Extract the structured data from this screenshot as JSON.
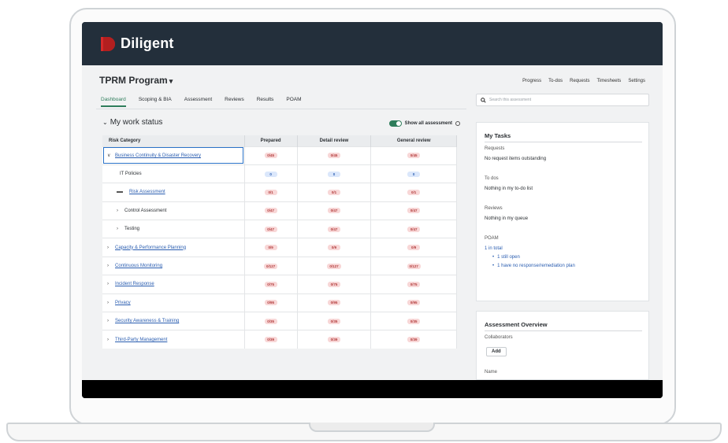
{
  "brand": {
    "name": "Diligent",
    "color": "#d72a2a"
  },
  "header": {
    "title": "TPRM Program",
    "links": [
      "Progress",
      "To-dos",
      "Requests",
      "Timesheets",
      "Settings"
    ],
    "search_placeholder": "Search this assessment"
  },
  "tabs": [
    {
      "label": "Dashboard",
      "active": true
    },
    {
      "label": "Scoping & BIA",
      "active": false
    },
    {
      "label": "Assessment",
      "active": false
    },
    {
      "label": "Reviews",
      "active": false
    },
    {
      "label": "Results",
      "active": false
    },
    {
      "label": "POAM",
      "active": false
    }
  ],
  "work_status": {
    "title": "My work status",
    "toggle_label": "Show all assessment",
    "toggle_on": true,
    "columns": [
      "Risk Category",
      "Prepared",
      "Detail review",
      "General review"
    ],
    "rows": [
      {
        "label": "Business Continuity & Disaster Recovery",
        "style": "link",
        "indent": 0,
        "expander": "open",
        "selected": true,
        "values": [
          "0/45",
          "0/45",
          "0/45"
        ],
        "badge": "red"
      },
      {
        "label": "IT Policies",
        "style": "plain",
        "indent": 2,
        "expander": "none",
        "selected": false,
        "values": [
          "0",
          "0",
          "0"
        ],
        "badge": "blue"
      },
      {
        "label": "Risk Assessment",
        "style": "link",
        "indent": 1,
        "expander": "bar",
        "selected": false,
        "values": [
          "0/1",
          "0/1",
          "0/1"
        ],
        "badge": "red"
      },
      {
        "label": "Control Assessment",
        "style": "plain",
        "indent": 1,
        "expander": "closed",
        "selected": false,
        "values": [
          "0/47",
          "0/47",
          "0/47"
        ],
        "badge": "red"
      },
      {
        "label": "Testing",
        "style": "plain",
        "indent": 1,
        "expander": "closed",
        "selected": false,
        "values": [
          "0/47",
          "0/47",
          "0/47"
        ],
        "badge": "red"
      },
      {
        "label": "Capacity & Performance Planning",
        "style": "link",
        "indent": 0,
        "expander": "closed",
        "selected": false,
        "values": [
          "0/9",
          "0/9",
          "0/9"
        ],
        "badge": "red"
      },
      {
        "label": "Continuous Monitoring",
        "style": "link",
        "indent": 0,
        "expander": "closed",
        "selected": false,
        "values": [
          "0/127",
          "0/127",
          "0/127"
        ],
        "badge": "red"
      },
      {
        "label": "Incident Response",
        "style": "link",
        "indent": 0,
        "expander": "closed",
        "selected": false,
        "values": [
          "0/75",
          "0/75",
          "0/75"
        ],
        "badge": "red"
      },
      {
        "label": "Privacy",
        "style": "link",
        "indent": 0,
        "expander": "closed",
        "selected": false,
        "values": [
          "0/95",
          "0/95",
          "0/95"
        ],
        "badge": "red"
      },
      {
        "label": "Security Awareness & Training",
        "style": "link",
        "indent": 0,
        "expander": "closed",
        "selected": false,
        "values": [
          "0/35",
          "0/35",
          "0/35"
        ],
        "badge": "red"
      },
      {
        "label": "Third-Party Management",
        "style": "link",
        "indent": 0,
        "expander": "closed",
        "selected": false,
        "values": [
          "0/39",
          "0/39",
          "0/39"
        ],
        "badge": "red"
      }
    ]
  },
  "my_tasks": {
    "title": "My Tasks",
    "requests_label": "Requests",
    "requests_value": "No request items outstanding",
    "todos_label": "To dos",
    "todos_value": "Nothing in my to-do list",
    "reviews_label": "Reviews",
    "reviews_value": "Nothing in my queue",
    "poam_label": "POAM",
    "poam_total": "1 in total",
    "poam_items": [
      "1 still open",
      "1 have no response/remediation plan"
    ]
  },
  "overview": {
    "title": "Assessment Overview",
    "collaborators_label": "Collaborators",
    "add_label": "Add",
    "name_label": "Name"
  }
}
